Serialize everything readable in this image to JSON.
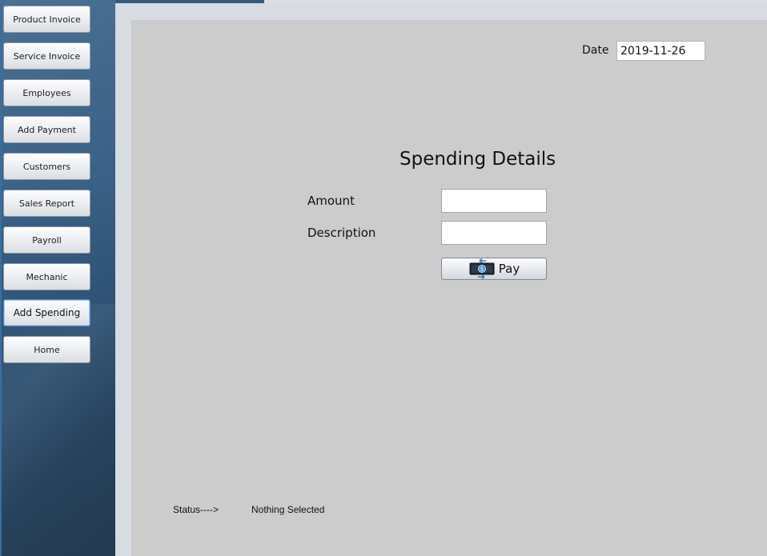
{
  "sidebar": {
    "items": [
      {
        "label": "Product Invoice"
      },
      {
        "label": "Service Invoice"
      },
      {
        "label": "Employees"
      },
      {
        "label": "Add Payment"
      },
      {
        "label": "Customers"
      },
      {
        "label": "Sales Report"
      },
      {
        "label": "Payroll"
      },
      {
        "label": "Mechanic"
      },
      {
        "label": "Add Spending",
        "active": true
      },
      {
        "label": "Home"
      }
    ]
  },
  "header": {
    "date_label": "Date",
    "date_value": "2019-11-26"
  },
  "form": {
    "title": "Spending Details",
    "amount_label": "Amount",
    "amount_value": "",
    "description_label": "Description",
    "description_value": "",
    "pay_button": {
      "label": "Pay",
      "icon": "money-transfer-icon"
    }
  },
  "status": {
    "label": "Status---->",
    "value": "Nothing Selected"
  },
  "colors": {
    "sidebar_bg": "#3a6186",
    "panel_bg": "#cccccc",
    "frame_bg": "#d7dbe2",
    "active_border": "#5b8ac0"
  }
}
